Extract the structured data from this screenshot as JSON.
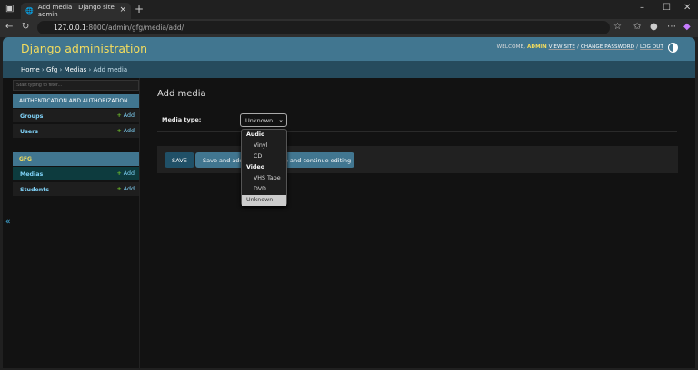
{
  "browser": {
    "tab_title": "Add media | Django site admin",
    "url_host": "127.0.0.1",
    "url_rest": ":8000/admin/gfg/media/add/"
  },
  "header": {
    "brand": "Django administration",
    "welcome": "WELCOME,",
    "user": "ADMIN",
    "view_site": "VIEW SITE",
    "change_password": "CHANGE PASSWORD",
    "log_out": "LOG OUT",
    "sep": "/"
  },
  "breadcrumbs": {
    "home": "Home",
    "app": "Gfg",
    "model": "Medias",
    "current": "Add media",
    "sep": "›"
  },
  "sidebar": {
    "filter_placeholder": "Start typing to filter...",
    "add_label": "Add",
    "collapse": "«",
    "apps": [
      {
        "caption": "AUTHENTICATION AND AUTHORIZATION",
        "models": [
          "Groups",
          "Users"
        ]
      },
      {
        "caption": "GFG",
        "models": [
          "Medias",
          "Students"
        ]
      }
    ]
  },
  "main": {
    "title": "Add media",
    "field_label": "Media type:",
    "selected": "Unknown",
    "dropdown": {
      "groups": [
        {
          "label": "Audio",
          "options": [
            "Vinyl",
            "CD"
          ]
        },
        {
          "label": "Video",
          "options": [
            "VHS Tape",
            "DVD"
          ]
        }
      ],
      "other": "Unknown"
    },
    "buttons": {
      "save": "SAVE",
      "save_add": "Save and add another",
      "save_continue": "Save and continue editing"
    }
  }
}
